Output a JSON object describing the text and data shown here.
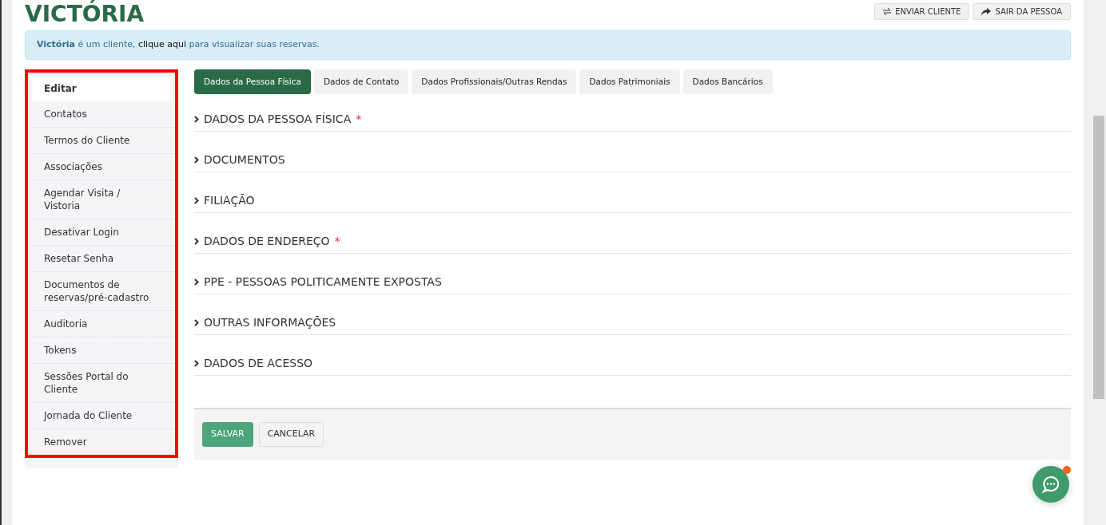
{
  "header": {
    "title": "VICTÓRIA",
    "buttons": [
      {
        "label": "ENVIAR CLIENTE",
        "kind": "transfer"
      },
      {
        "label": "SAIR DA PESSOA",
        "kind": "exit"
      }
    ]
  },
  "alert": {
    "before": "**Victória** é um cliente,",
    "link": "clique aqui",
    "after": "para visualizar suas reservas."
  },
  "sidebar": {
    "items": [
      {
        "label": "Editar",
        "selected": true
      },
      {
        "label": "Contatos",
        "selected": false
      },
      {
        "label": "Termos do Cliente",
        "selected": false
      },
      {
        "label": "Associações",
        "selected": false
      },
      {
        "label": "Agendar Visita / Vistoria",
        "selected": false
      },
      {
        "label": "Desativar Login",
        "selected": false
      },
      {
        "label": "Resetar Senha",
        "selected": false
      },
      {
        "label": "Documentos de reservas/pré-cadastro",
        "selected": false
      },
      {
        "label": "Auditoria",
        "selected": false
      },
      {
        "label": "Tokens",
        "selected": false
      },
      {
        "label": "Sessões Portal do Cliente",
        "selected": false
      },
      {
        "label": "Jornada do Cliente",
        "selected": false
      },
      {
        "label": "Remover",
        "selected": false
      }
    ]
  },
  "tabs": [
    {
      "label": "Dados da Pessoa Física",
      "selected": true
    },
    {
      "label": "Dados de Contato",
      "selected": false
    },
    {
      "label": "Dados Profissionais/Outras Rendas",
      "selected": false
    },
    {
      "label": "Dados Patrimoniais",
      "selected": false
    },
    {
      "label": "Dados Bancários",
      "selected": false
    }
  ],
  "sections": [
    {
      "title": "DADOS DA PESSOA FÍSICA",
      "mark": "*"
    },
    {
      "title": "DOCUMENTOS"
    },
    {
      "title": "FILIAÇÃO"
    },
    {
      "title": "DADOS DE ENDEREÇO",
      "mark": "*"
    },
    {
      "title": "PPE - PESSOAS POLITICAMENTE EXPOSTAS"
    },
    {
      "title": "OUTRAS INFORMAÇÕES"
    },
    {
      "title": "DADOS DE ACESSO"
    }
  ],
  "form_actions": [
    {
      "label": "SALVAR",
      "kind": "primary"
    },
    {
      "label": "CANCELAR",
      "kind": "secondary"
    }
  ],
  "chat": {
    "notification": true
  }
}
